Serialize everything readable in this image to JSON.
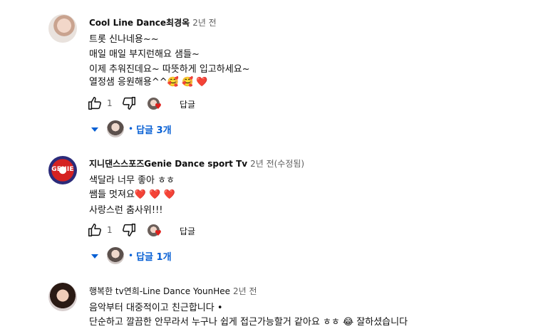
{
  "comments": [
    {
      "author": "Cool Line Dance최경옥",
      "time": "2년 전",
      "lines": [
        "트롯 신나네용~~",
        "매일 매일 부지런해요 샘들~",
        "이제 추워진데요~ 따뜻하게 입고하세요~",
        "열정샘 응원해용^^🥰 🥰 ❤️"
      ],
      "likes": "1",
      "reply_label": "답글",
      "replies_label": "답글 3개"
    },
    {
      "author": "지니댄스스포즈Genie Dance sport Tv",
      "time": "2년 전(수정됨)",
      "avatar_text": "GENIE",
      "lines": [
        "색달라 너무 좋아 ㅎㅎ",
        "쌤들 멋져요❤️ ❤️ ❤️",
        "사랑스런 춤사위!!!"
      ],
      "likes": "1",
      "reply_label": "답글",
      "replies_label": "답글 1개"
    },
    {
      "author": "행복한 tv연희-Line Dance YounHee",
      "time": "2년 전",
      "lines": [
        "음악부터 대중적이고 친근합니다 •",
        "단순하고 깔끔한 안무라서 누구나 쉽게 접근가능할거  같아요 ㅎㅎ 😂 잘하셨습니다"
      ]
    }
  ],
  "icons": {
    "like": "thumb-up-icon",
    "dislike": "thumb-down-icon",
    "creator_heart": "creator-heart-icon",
    "expand": "caret-down-icon"
  },
  "colors": {
    "link": "#065fd4",
    "heart": "#e0201c",
    "secondary_text": "#606060"
  }
}
